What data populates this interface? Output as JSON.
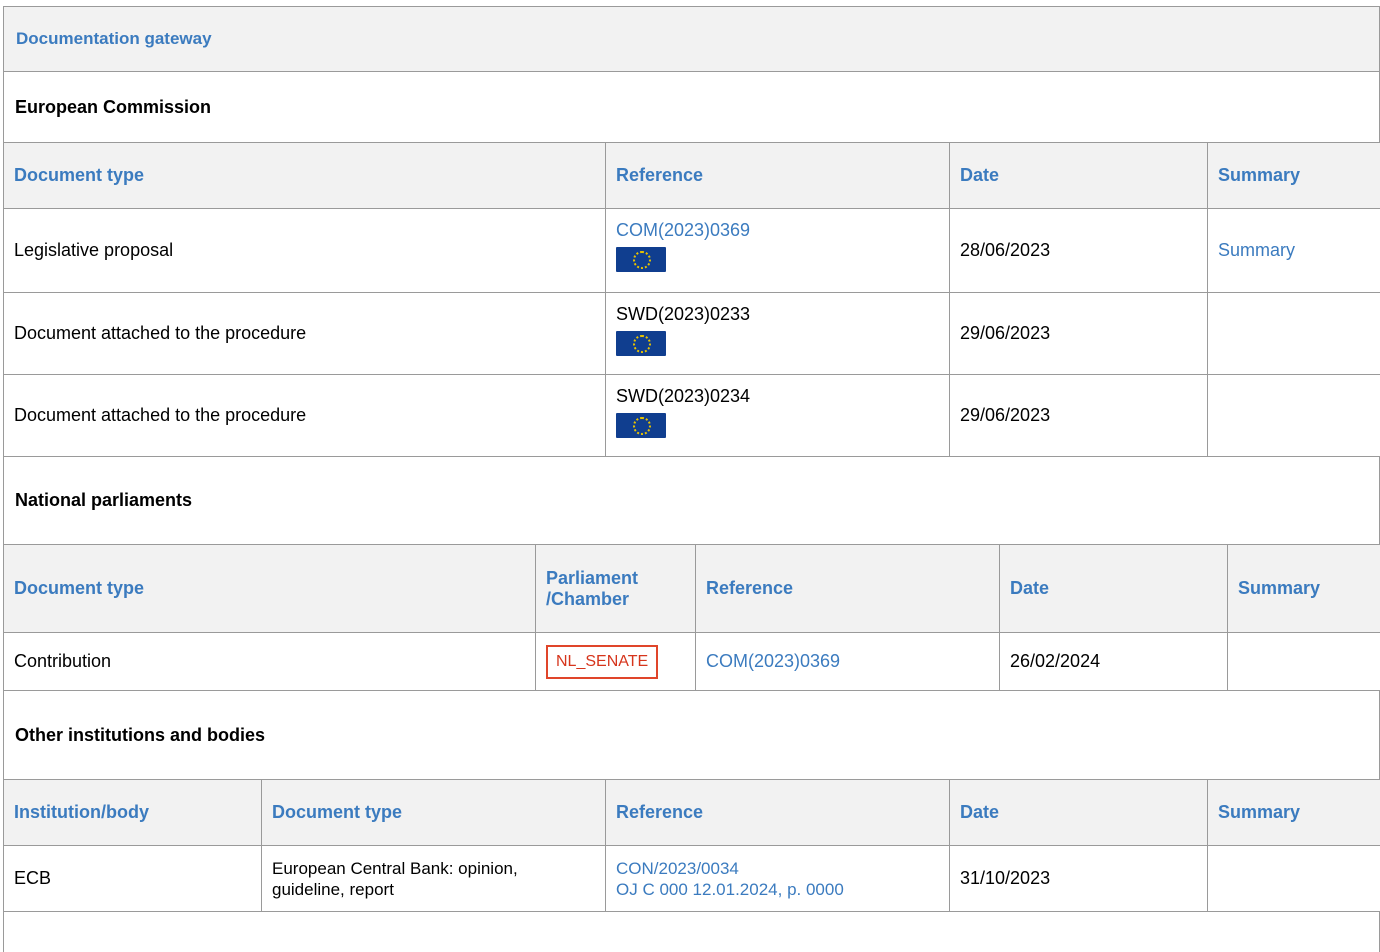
{
  "gateway_title": "Documentation gateway",
  "commission": {
    "title": "European Commission",
    "headers": [
      "Document type",
      "Reference",
      "Date",
      "Summary"
    ],
    "rows": [
      {
        "type": "Legislative proposal",
        "reference": "COM(2023)0369",
        "date": "28/06/2023",
        "summary": "Summary"
      },
      {
        "type": "Document attached to the procedure",
        "reference": "SWD(2023)0233",
        "date": "29/06/2023",
        "summary": ""
      },
      {
        "type": "Document attached to the procedure",
        "reference": "SWD(2023)0234",
        "date": "29/06/2023",
        "summary": ""
      }
    ]
  },
  "national": {
    "title": "National parliaments",
    "headers": [
      "Document type",
      "Parliament /Chamber",
      "Reference",
      "Date",
      "Summary"
    ],
    "rows": [
      {
        "type": "Contribution",
        "chamber": "NL_SENATE",
        "reference": "COM(2023)0369",
        "date": "26/02/2024",
        "summary": ""
      }
    ]
  },
  "other": {
    "title": "Other institutions and bodies",
    "headers": [
      "Institution/body",
      "Document type",
      "Reference",
      "Date",
      "Summary"
    ],
    "rows": [
      {
        "institution": "ECB",
        "type": "European Central Bank: opinion, guideline, report",
        "reference": "CON/2023/0034",
        "reference2": "OJ C 000 12.01.2024, p. 0000",
        "date": "31/10/2023",
        "summary": ""
      }
    ]
  },
  "colors": {
    "link": "#3b7bbf",
    "badge": "#e0452a",
    "header_bg": "#f2f2f2",
    "flag": "#103e8f"
  },
  "icons": {
    "eu_flag": "eu-flag-icon"
  }
}
